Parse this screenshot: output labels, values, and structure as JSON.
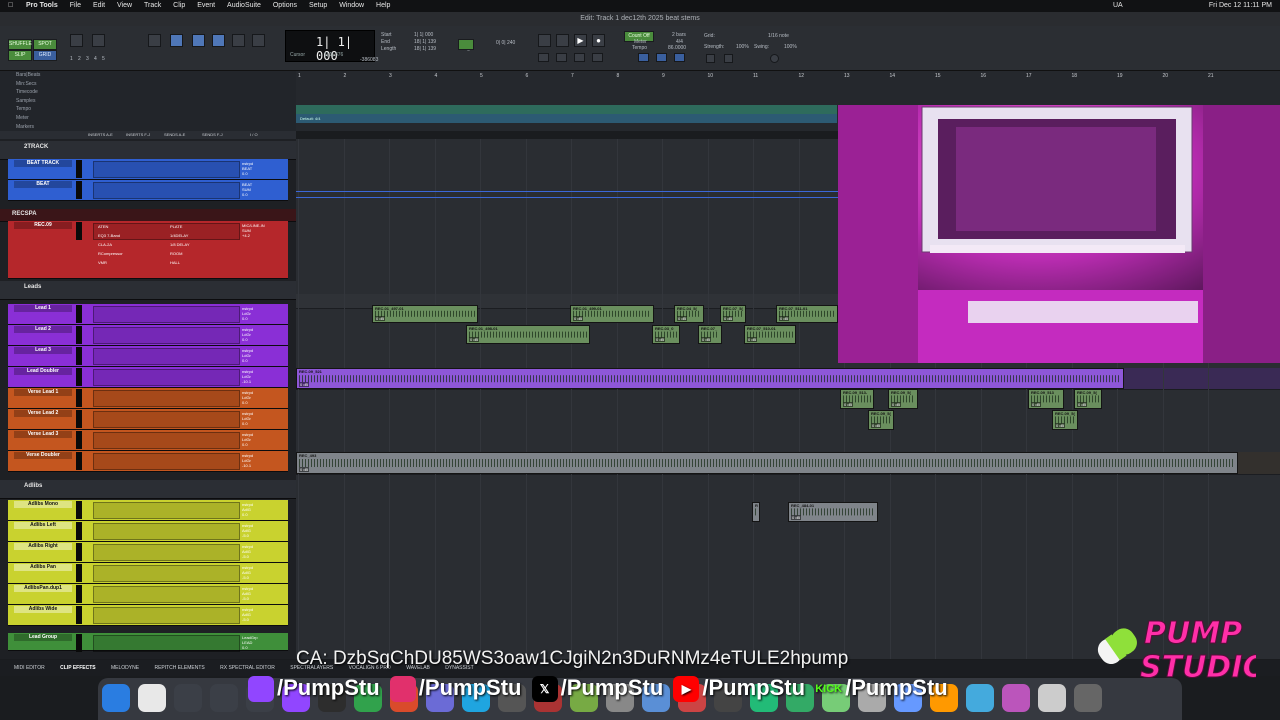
{
  "menubar": {
    "apple": "",
    "app": "Pro Tools",
    "items": [
      "File",
      "Edit",
      "View",
      "Track",
      "Clip",
      "Event",
      "AudioSuite",
      "Options",
      "Setup",
      "Window",
      "Help"
    ],
    "clock": "Fri Dec 12  11:11 PM",
    "status_ua": "UA"
  },
  "window_title": "Edit: Track 1 dec12th 2025 beat stems",
  "toolbar": {
    "modes": [
      "SHUFFLE",
      "SPOT",
      "SLIP",
      "GRID"
    ],
    "counter_main": "1| 1| 000",
    "counter_label": "Cursor",
    "start": "1| 1| 000",
    "end": "18| 1| 139",
    "length": "18| 1| 139",
    "start_label": "Start",
    "end_label": "End",
    "length_label": "Length",
    "nudge_label": "Nudge",
    "nudge_value": "0| 0| 240",
    "grid_label": "Grid:",
    "grid_value": "1/16 note",
    "strength_label": "Strength:",
    "strength_value": "100%",
    "swing_label": "Swing:",
    "swing_value": "100%",
    "count_off": "Count Off",
    "meter": "Meter",
    "tempo": "Tempo",
    "bars": "2 bars",
    "meter_value": "4/4",
    "tempo_value": "86.0000",
    "cursor_pos": "1| 1| 376",
    "sample": "-386083",
    "numbers": [
      "1",
      "2",
      "3",
      "4",
      "5"
    ]
  },
  "rulers": [
    "Bars|Beats",
    "Min:Secs",
    "Timecode",
    "Samples",
    "Tempo",
    "Meter",
    "Markers"
  ],
  "bar_ticks": [
    "1",
    "2",
    "3",
    "4",
    "5",
    "6",
    "7",
    "8",
    "9",
    "10",
    "11",
    "12",
    "13",
    "14",
    "15",
    "16",
    "17",
    "18",
    "19",
    "20",
    "21"
  ],
  "meter_marker": "Default: 4/4",
  "mixer_head": [
    "INSERTS A-E",
    "INSERTS F-J",
    "SENDS A-E",
    "SENDS F-J",
    "I / O"
  ],
  "folders": {
    "two_track": "2TRACK",
    "recspa": "RECSPA",
    "leads": "Leads",
    "adlibs": "Adlibs"
  },
  "tracks": [
    {
      "name": "BEAT TRACK",
      "color": "blue",
      "io1": "nstrpd",
      "io2": "BEAT",
      "vol": "0.0"
    },
    {
      "name": "BEAT",
      "color": "blue",
      "io1": "BEAT",
      "io2": "SUM",
      "vol": "0.0"
    },
    {
      "name": "REC.09",
      "color": "red",
      "io1": "MIC/LINE-IN",
      "io2": "SUM",
      "vol": "+4.2"
    },
    {
      "name": "Lead 1",
      "color": "purple",
      "io1": "nstrpd",
      "io2": "LdGr",
      "vol": "0.0"
    },
    {
      "name": "Lead 2",
      "color": "purple",
      "io1": "nstrpd",
      "io2": "LdGr",
      "vol": "0.0"
    },
    {
      "name": "Lead 3",
      "color": "purple",
      "io1": "nstrpd",
      "io2": "LdGr",
      "vol": "0.0"
    },
    {
      "name": "Lead Doubler",
      "color": "purple",
      "io1": "nstrpd",
      "io2": "LdGr",
      "vol": "-10.1"
    },
    {
      "name": "Verse Lead 1",
      "color": "orange",
      "io1": "nstrpd",
      "io2": "LdGr",
      "vol": "0.0"
    },
    {
      "name": "Verse Lead 2",
      "color": "orange",
      "io1": "nstrpd",
      "io2": "LdGr",
      "vol": "0.0"
    },
    {
      "name": "Verse Lead 3",
      "color": "orange",
      "io1": "nstrpd",
      "io2": "LdGr",
      "vol": "0.0"
    },
    {
      "name": "Verse Doubler",
      "color": "orange",
      "io1": "nstrpd",
      "io2": "LdGr",
      "vol": "-10.1"
    },
    {
      "name": "Adlibs Mono",
      "color": "yellow",
      "io1": "nstrpd",
      "io2": "AdlG",
      "vol": "0.0"
    },
    {
      "name": "Adlibs Left",
      "color": "yellow",
      "io1": "nstrpd",
      "io2": "AdlG",
      "vol": "-5.0"
    },
    {
      "name": "Adlibs Right",
      "color": "yellow",
      "io1": "nstrpd",
      "io2": "AdlG",
      "vol": "-5.0"
    },
    {
      "name": "Adlibs Pan",
      "color": "yellow",
      "io1": "nstrpd",
      "io2": "AdlG",
      "vol": "-5.0"
    },
    {
      "name": "AdlibsPan.dup1",
      "color": "yellow",
      "io1": "nstrpd",
      "io2": "AdlG",
      "vol": "-5.0"
    },
    {
      "name": "Adlibs Wide",
      "color": "yellow",
      "io1": "nstrpd",
      "io2": "AdlG",
      "vol": "-5.0"
    },
    {
      "name": "Lead Group",
      "color": "green",
      "io1": "LeadGrp",
      "io2": "LEAD",
      "vol": "0.0"
    }
  ],
  "rec_inserts": [
    "ATEN",
    "EQ3 7-Band",
    "CLA-2A",
    "RCompressor",
    "VMR"
  ],
  "rec_sends": [
    "PLATE",
    "1/4DELAY",
    "1/8 DELAY",
    "ROOM",
    "HALL"
  ],
  "clips": [
    {
      "name": "REC.01_497-01",
      "db": "0 dB"
    },
    {
      "name": "REC.01_498-01",
      "db": "0 dB"
    },
    {
      "name": "REC.01_499-01",
      "db": "0 dB"
    },
    {
      "name": "REC.03_0",
      "db": "0 dB"
    },
    {
      "name": "REC.04_5(",
      "db": "0 dB"
    },
    {
      "name": "REC.07_",
      "db": "0 dB"
    },
    {
      "name": "REC.07_5(",
      "db": "0 dB"
    },
    {
      "name": "REC.07_510-01",
      "db": "0 dB"
    },
    {
      "name": "REC.07_511-01",
      "db": "0 dB"
    },
    {
      "name": "REC.09_521",
      "db": "0 dB"
    },
    {
      "name": "REC.09_513-",
      "db": "0 dB"
    },
    {
      "name": "REC.09_5(",
      "db": "0 dB"
    },
    {
      "name": "REC.09_5(",
      "db": "0 dB"
    },
    {
      "name": "REC.09_513",
      "db": "0 dB"
    },
    {
      "name": "REC.09_5(",
      "db": "0 dB"
    },
    {
      "name": "REC.09_5(",
      "db": "0 dB"
    },
    {
      "name": "REC_493",
      "db": "0 dB"
    },
    {
      "name": "R",
      "db": ""
    },
    {
      "name": "REC_484-01",
      "db": "0 dB"
    }
  ],
  "bottom_tabs": [
    "MIDI EDITOR",
    "CLIP EFFECTS",
    "MELODYNE",
    "REPITCH ELEMENTS",
    "RX SPECTRAL EDITOR",
    "SPECTRALAYERS",
    "VOCALIGN 6 PRO",
    "WAVELAB",
    "DYNASSIST"
  ],
  "overlay": {
    "ca": "CA: DzbSqChDU85WS3oaw1CJgiN2n3DuRNMz4eTULE2hpump",
    "socials": [
      "/PumpStu",
      "/PumpStu",
      "/PumpStu",
      "/PumpStu",
      "/PumpStu"
    ],
    "kick_label": "KICK",
    "logo_line1": "PUMP",
    "logo_line2": "STUDIO"
  },
  "colors": {
    "blue": "#2f5fd1",
    "red": "#b5272b",
    "purple": "#8a2fd6",
    "orange": "#c4561f",
    "yellow": "#c9d22f",
    "green": "#3f8f3a",
    "magenta_logo": "#ff2fa8"
  }
}
